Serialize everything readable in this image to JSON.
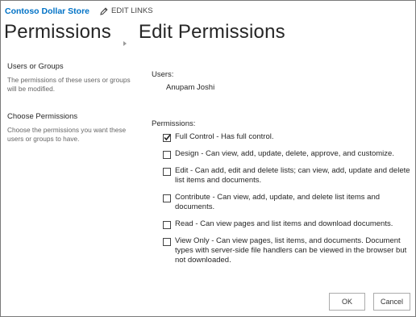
{
  "header": {
    "site_title": "Contoso Dollar Store",
    "edit_links_label": "EDIT LINKS",
    "edit_links_icon": "pencil-icon"
  },
  "page": {
    "breadcrumb_parent": "Permissions",
    "breadcrumb_separator_icon": "breadcrumb-arrow-icon",
    "title": "Edit Permissions"
  },
  "users_section": {
    "heading": "Users or Groups",
    "description": "The permissions of these users or groups will be modified.",
    "field_label": "Users:",
    "users": [
      "Anupam Joshi"
    ]
  },
  "permissions_section": {
    "heading": "Choose Permissions",
    "description": "Choose the permissions you want these users or groups to have.",
    "field_label": "Permissions:",
    "options": [
      {
        "label": "Full Control - Has full control.",
        "checked": true
      },
      {
        "label": "Design - Can view, add, update, delete, approve, and customize.",
        "checked": false
      },
      {
        "label": "Edit - Can add, edit and delete lists; can view, add, update and delete list items and documents.",
        "checked": false
      },
      {
        "label": "Contribute - Can view, add, update, and delete list items and documents.",
        "checked": false
      },
      {
        "label": "Read - Can view pages and list items and download documents.",
        "checked": false
      },
      {
        "label": "View Only - Can view pages, list items, and documents. Document types with server-side file handlers can be viewed in the browser but not downloaded.",
        "checked": false
      }
    ]
  },
  "buttons": {
    "ok_label": "OK",
    "cancel_label": "Cancel"
  },
  "colors": {
    "site_title": "#0072c6",
    "frame_border": "#7a7a7a"
  }
}
